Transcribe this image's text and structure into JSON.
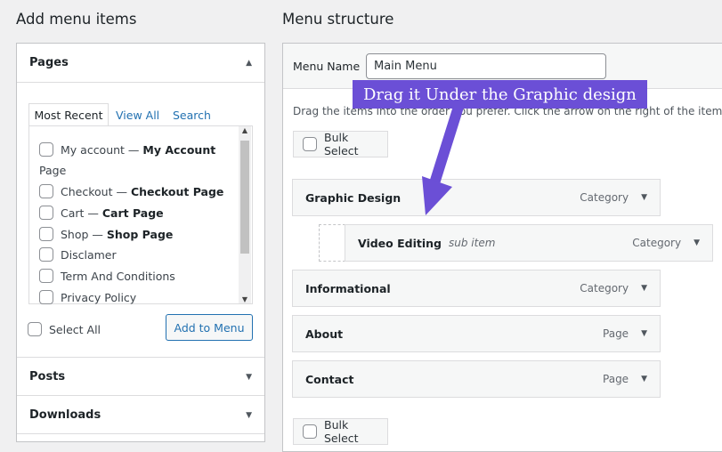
{
  "left": {
    "title": "Add menu items",
    "pages_section": "Pages",
    "tabs": [
      "Most Recent",
      "View All",
      "Search"
    ],
    "pages": [
      {
        "prefix": "My account — ",
        "bold": "My Account"
      },
      {
        "continuation": "Page"
      },
      {
        "prefix": "Checkout — ",
        "bold": "Checkout Page"
      },
      {
        "prefix": "Cart — ",
        "bold": "Cart Page"
      },
      {
        "prefix": "Shop — ",
        "bold": "Shop Page"
      },
      {
        "prefix": "Disclamer",
        "bold": ""
      },
      {
        "prefix": "Term And Conditions",
        "bold": ""
      },
      {
        "prefix": "Privacy Policy",
        "bold": ""
      }
    ],
    "select_all": "Select All",
    "add_to_menu": "Add to Menu",
    "posts_section": "Posts",
    "downloads_section": "Downloads"
  },
  "right": {
    "title": "Menu structure",
    "menu_name_label": "Menu Name",
    "menu_name_value": "Main Menu",
    "instructions": "Drag the items into the order you prefer. Click the arrow on the right of the item to r",
    "bulk_select": "Bulk Select",
    "items": [
      {
        "label": "Graphic Design",
        "type": "Category"
      },
      {
        "label": "Video Editing",
        "sub": "sub item",
        "type": "Category"
      },
      {
        "label": "Informational",
        "type": "Category"
      },
      {
        "label": "About",
        "type": "Page"
      },
      {
        "label": "Contact",
        "type": "Page"
      }
    ]
  },
  "annotation": {
    "text": "Drag it Under the Graphic design",
    "color": "#6b4fd6"
  }
}
